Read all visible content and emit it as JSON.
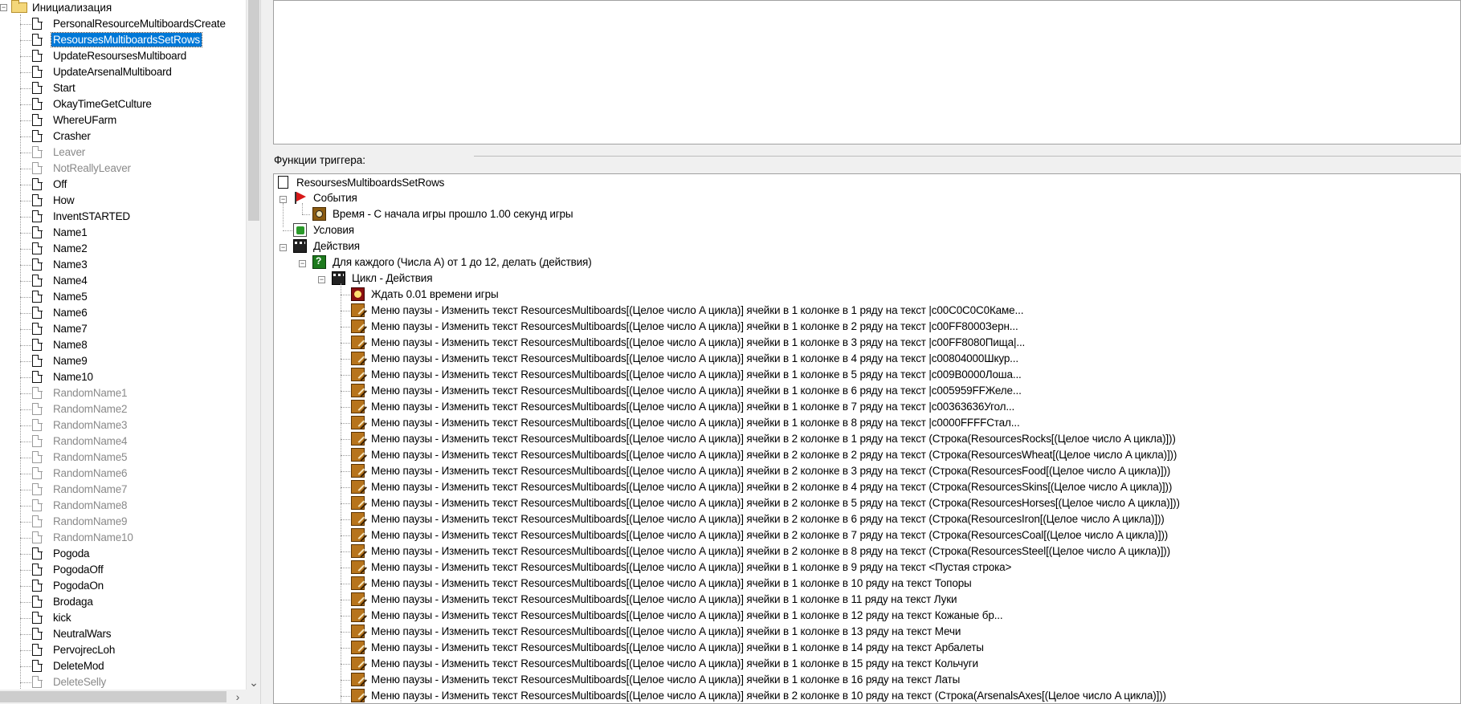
{
  "trigger_tree": {
    "folder_label": "Инициализация",
    "items": [
      {
        "label": "PersonalResourceMultiboardsCreate",
        "disabled": false,
        "selected": false
      },
      {
        "label": "ResoursesMultiboardsSetRows",
        "disabled": false,
        "selected": true
      },
      {
        "label": "UpdateResoursesMultiboard",
        "disabled": false,
        "selected": false
      },
      {
        "label": "UpdateArsenalMultiboard",
        "disabled": false,
        "selected": false
      },
      {
        "label": "Start",
        "disabled": false,
        "selected": false
      },
      {
        "label": "OkayTimeGetCulture",
        "disabled": false,
        "selected": false
      },
      {
        "label": "WhereUFarm",
        "disabled": false,
        "selected": false
      },
      {
        "label": "Crasher",
        "disabled": false,
        "selected": false
      },
      {
        "label": "Leaver",
        "disabled": true,
        "selected": false
      },
      {
        "label": "NotReallyLeaver",
        "disabled": true,
        "selected": false
      },
      {
        "label": "Off",
        "disabled": false,
        "selected": false
      },
      {
        "label": "How",
        "disabled": false,
        "selected": false
      },
      {
        "label": "InventSTARTED",
        "disabled": false,
        "selected": false
      },
      {
        "label": "Name1",
        "disabled": false,
        "selected": false
      },
      {
        "label": "Name2",
        "disabled": false,
        "selected": false
      },
      {
        "label": "Name3",
        "disabled": false,
        "selected": false
      },
      {
        "label": "Name4",
        "disabled": false,
        "selected": false
      },
      {
        "label": "Name5",
        "disabled": false,
        "selected": false
      },
      {
        "label": "Name6",
        "disabled": false,
        "selected": false
      },
      {
        "label": "Name7",
        "disabled": false,
        "selected": false
      },
      {
        "label": "Name8",
        "disabled": false,
        "selected": false
      },
      {
        "label": "Name9",
        "disabled": false,
        "selected": false
      },
      {
        "label": "Name10",
        "disabled": false,
        "selected": false
      },
      {
        "label": "RandomName1",
        "disabled": true,
        "selected": false
      },
      {
        "label": "RandomName2",
        "disabled": true,
        "selected": false
      },
      {
        "label": "RandomName3",
        "disabled": true,
        "selected": false
      },
      {
        "label": "RandomName4",
        "disabled": true,
        "selected": false
      },
      {
        "label": "RandomName5",
        "disabled": true,
        "selected": false
      },
      {
        "label": "RandomName6",
        "disabled": true,
        "selected": false
      },
      {
        "label": "RandomName7",
        "disabled": true,
        "selected": false
      },
      {
        "label": "RandomName8",
        "disabled": true,
        "selected": false
      },
      {
        "label": "RandomName9",
        "disabled": true,
        "selected": false
      },
      {
        "label": "RandomName10",
        "disabled": true,
        "selected": false
      },
      {
        "label": "Pogoda",
        "disabled": false,
        "selected": false
      },
      {
        "label": "PogodaOff",
        "disabled": false,
        "selected": false
      },
      {
        "label": "PogodaOn",
        "disabled": false,
        "selected": false
      },
      {
        "label": "Brodaga",
        "disabled": false,
        "selected": false
      },
      {
        "label": "kick",
        "disabled": false,
        "selected": false
      },
      {
        "label": "NeutralWars",
        "disabled": false,
        "selected": false
      },
      {
        "label": "PervojrecLoh",
        "disabled": false,
        "selected": false
      },
      {
        "label": "DeleteMod",
        "disabled": false,
        "selected": false
      },
      {
        "label": "DeleteSelly",
        "disabled": true,
        "selected": false
      }
    ]
  },
  "functions_panel": {
    "label": "Функции триггера:",
    "trigger_name": "ResoursesMultiboardsSetRows",
    "events_label": "События",
    "event": "Время - С начала игры прошло 1.00 секунд игры",
    "conditions_label": "Условия",
    "actions_label": "Действия",
    "loop_label": "Для каждого (Числа A) от 1 до 12, делать (действия)",
    "loop_actions_label": "Цикл - Действия",
    "wait_action": "Ждать 0.01 времени игры",
    "actions": [
      "Меню паузы - Изменить текст ResourcesMultiboards[(Целое число A цикла)] ячейки в 1 колонке в 1 ряду на текст |c00C0C0C0Каме...",
      "Меню паузы - Изменить текст ResourcesMultiboards[(Целое число A цикла)] ячейки в 1 колонке в 2 ряду на текст |c00FF8000Зерн...",
      "Меню паузы - Изменить текст ResourcesMultiboards[(Целое число A цикла)] ячейки в 1 колонке в 3 ряду на текст |c00FF8080Пища|...",
      "Меню паузы - Изменить текст ResourcesMultiboards[(Целое число A цикла)] ячейки в 1 колонке в 4 ряду на текст |c00804000Шкур...",
      "Меню паузы - Изменить текст ResourcesMultiboards[(Целое число A цикла)] ячейки в 1 колонке в 5 ряду на текст |c009B0000Лоша...",
      "Меню паузы - Изменить текст ResourcesMultiboards[(Целое число A цикла)] ячейки в 1 колонке в 6 ряду на текст |c005959FFЖеле...",
      "Меню паузы - Изменить текст ResourcesMultiboards[(Целое число A цикла)] ячейки в 1 колонке в 7 ряду на текст |c00363636Угол...",
      "Меню паузы - Изменить текст ResourcesMultiboards[(Целое число A цикла)] ячейки в 1 колонке в 8 ряду на текст |c0000FFFFСтал...",
      "Меню паузы - Изменить текст ResourcesMultiboards[(Целое число A цикла)] ячейки в 2 колонке в 1 ряду на текст (Строка(ResourcesRocks[(Целое число A цикла)]))",
      "Меню паузы - Изменить текст ResourcesMultiboards[(Целое число A цикла)] ячейки в 2 колонке в 2 ряду на текст (Строка(ResourcesWheat[(Целое число A цикла)]))",
      "Меню паузы - Изменить текст ResourcesMultiboards[(Целое число A цикла)] ячейки в 2 колонке в 3 ряду на текст (Строка(ResourcesFood[(Целое число A цикла)]))",
      "Меню паузы - Изменить текст ResourcesMultiboards[(Целое число A цикла)] ячейки в 2 колонке в 4 ряду на текст (Строка(ResourcesSkins[(Целое число A цикла)]))",
      "Меню паузы - Изменить текст ResourcesMultiboards[(Целое число A цикла)] ячейки в 2 колонке в 5 ряду на текст (Строка(ResourcesHorses[(Целое число A цикла)]))",
      "Меню паузы - Изменить текст ResourcesMultiboards[(Целое число A цикла)] ячейки в 2 колонке в 6 ряду на текст (Строка(ResourcesIron[(Целое число A цикла)]))",
      "Меню паузы - Изменить текст ResourcesMultiboards[(Целое число A цикла)] ячейки в 2 колонке в 7 ряду на текст (Строка(ResourcesCoal[(Целое число A цикла)]))",
      "Меню паузы - Изменить текст ResourcesMultiboards[(Целое число A цикла)] ячейки в 2 колонке в 8 ряду на текст (Строка(ResourcesSteel[(Целое число A цикла)]))",
      "Меню паузы - Изменить текст ResourcesMultiboards[(Целое число A цикла)] ячейки в 1 колонке в 9 ряду на текст <Пустая строка>",
      "Меню паузы - Изменить текст ResourcesMultiboards[(Целое число A цикла)] ячейки в 1 колонке в 10 ряду на текст Топоры",
      "Меню паузы - Изменить текст ResourcesMultiboards[(Целое число A цикла)] ячейки в 1 колонке в 11 ряду на текст Луки",
      "Меню паузы - Изменить текст ResourcesMultiboards[(Целое число A цикла)] ячейки в 1 колонке в 12 ряду на текст Кожаные бр...",
      "Меню паузы - Изменить текст ResourcesMultiboards[(Целое число A цикла)] ячейки в 1 колонке в 13 ряду на текст Мечи",
      "Меню паузы - Изменить текст ResourcesMultiboards[(Целое число A цикла)] ячейки в 1 колонке в 14 ряду на текст Арбалеты",
      "Меню паузы - Изменить текст ResourcesMultiboards[(Целое число A цикла)] ячейки в 1 колонке в 15 ряду на текст Кольчуги",
      "Меню паузы - Изменить текст ResourcesMultiboards[(Целое число A цикла)] ячейки в 1 колонке в 16 ряду на текст Латы",
      "Меню паузы - Изменить текст ResourcesMultiboards[(Целое число A цикла)] ячейки в 2 колонке в 10 ряду на текст (Строка(ArsenalsAxes[(Целое число A цикла)]))"
    ]
  }
}
